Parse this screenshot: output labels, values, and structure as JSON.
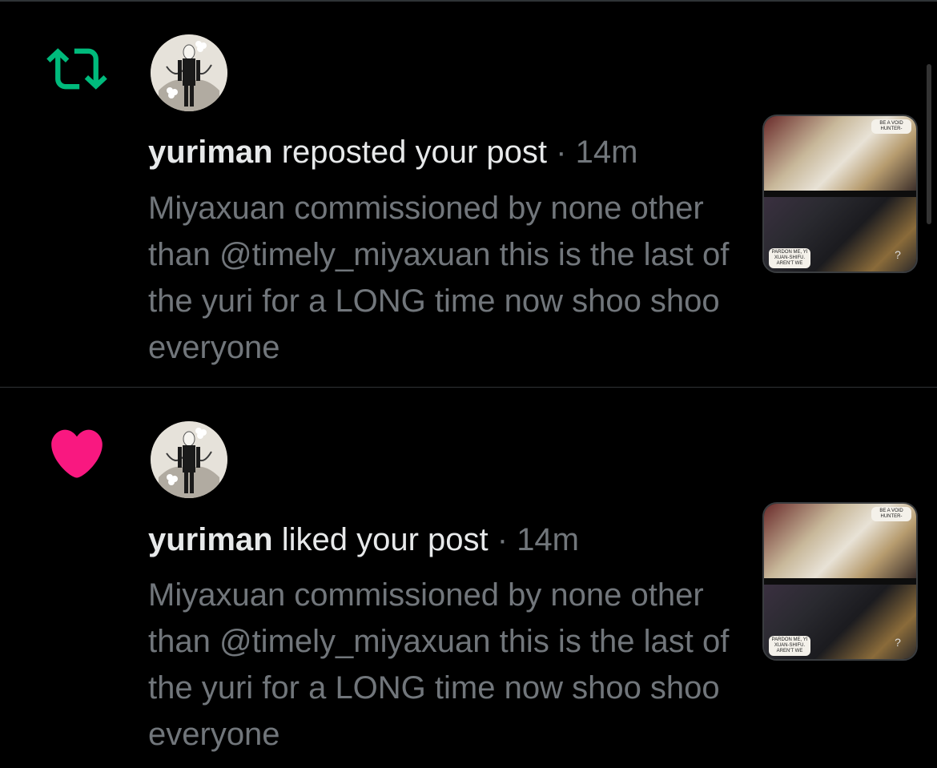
{
  "colors": {
    "background": "#000000",
    "divider": "#2f3336",
    "primary_text": "#e7e9ea",
    "secondary_text": "#71767b",
    "repost_green": "#00ba7c",
    "like_pink": "#f91880"
  },
  "notifications": [
    {
      "type": "repost",
      "icon": "repost-icon",
      "user": "yuriman",
      "action": " reposted your post",
      "separator": " · ",
      "time": "14m",
      "text": "Miyaxuan commissioned by none other than @timely_miyaxuan this is the last of the yuri for a LONG time now shoo shoo everyone",
      "thumbnail": {
        "bubble_top": "BE A VOID HUNTER-",
        "bubble_bottom": "PARDON ME, YI XUAN-SHIFU. AREN'T WE",
        "mark": "?"
      }
    },
    {
      "type": "like",
      "icon": "heart-icon",
      "user": "yuriman",
      "action": " liked your post",
      "separator": " · ",
      "time": "14m",
      "text": "Miyaxuan commissioned by none other than @timely_miyaxuan this is the last of the yuri for a LONG time now shoo shoo everyone",
      "thumbnail": {
        "bubble_top": "BE A VOID HUNTER-",
        "bubble_bottom": "PARDON ME, YI XUAN-SHIFU. AREN'T WE",
        "mark": "?"
      }
    }
  ]
}
